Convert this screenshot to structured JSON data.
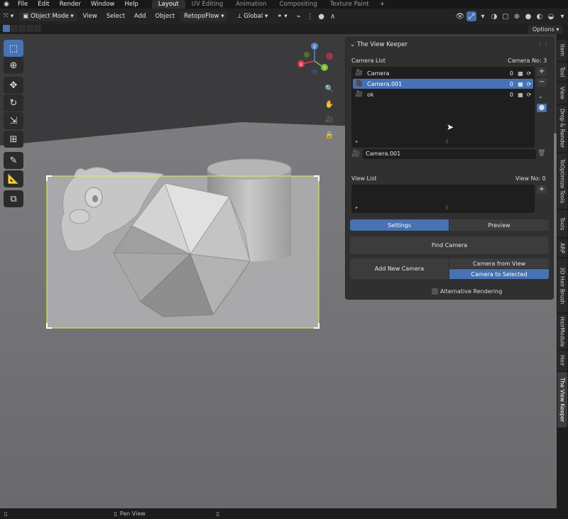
{
  "topbar": {
    "menus": [
      "File",
      "Edit",
      "Render",
      "Window",
      "Help"
    ],
    "workspaces": [
      "Layout",
      "UV Editing",
      "Animation",
      "Compositing",
      "Texture Paint"
    ],
    "active_workspace": "Layout"
  },
  "header": {
    "mode": "Object Mode",
    "view": "View",
    "select": "Select",
    "add": "Add",
    "object": "Object",
    "retopoflow": "RetopoFlow",
    "transform": "Global",
    "options": "Options"
  },
  "gizmo": {
    "x": "X",
    "y": "Y",
    "z": "Z"
  },
  "sidebar_tabs": [
    "Item",
    "Tool",
    "View",
    "Drop & Render",
    "ToOptimize Tools",
    "Tools",
    "ARP",
    "3D Hair Brush",
    "HairModule",
    "Hair",
    "The View Keeper"
  ],
  "active_sidebar_tab": "The View Keeper",
  "panel": {
    "title": "The View Keeper",
    "camera_list_label": "Camera List",
    "camera_no_label": "Camera No:",
    "camera_no": "3",
    "cameras": [
      {
        "name": "Camera",
        "count": "0",
        "selected": false
      },
      {
        "name": "Camera.001",
        "count": "0",
        "selected": true
      },
      {
        "name": "ok",
        "count": "0",
        "selected": false
      }
    ],
    "active_camera_name": "Camera.001",
    "view_list_label": "View List",
    "view_no_label": "View No:",
    "view_no": "0",
    "tabs": [
      "Settings",
      "Preview"
    ],
    "active_tab": "Settings",
    "find_camera": "Find Camera",
    "add_new_camera": "Add New Camera",
    "camera_from_view": "Camera from View",
    "camera_to_selected": "Camera to Selected",
    "alternative_rendering": "Alternative Rendering"
  },
  "status": {
    "pan_view": "Pan View"
  },
  "colors": {
    "accent": "#4772b3",
    "camera_frame": "#e8e85a"
  }
}
